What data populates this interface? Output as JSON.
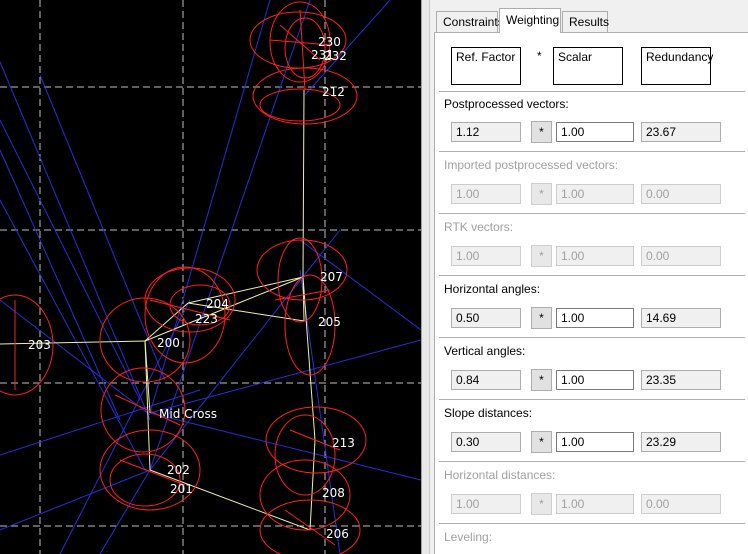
{
  "tabs": [
    "Constraints",
    "Weighting",
    "Results"
  ],
  "active_tab": "Weighting",
  "header": {
    "ref_factor": "Ref. Factor",
    "multiply": "*",
    "scalar": "Scalar",
    "redundancy": "Redundancy"
  },
  "sections": [
    {
      "title": "Postprocessed vectors:",
      "ref": "1.12",
      "op": "*",
      "scalar": "1.00",
      "redundancy": "23.67",
      "enabled": true
    },
    {
      "title": "Imported postprocessed vectors:",
      "ref": "1.00",
      "op": "*",
      "scalar": "1.00",
      "redundancy": "0.00",
      "enabled": false
    },
    {
      "title": "RTK vectors:",
      "ref": "1.00",
      "op": "*",
      "scalar": "1.00",
      "redundancy": "0.00",
      "enabled": false
    },
    {
      "title": "Horizontal angles:",
      "ref": "0.50",
      "op": "*",
      "scalar": "1.00",
      "redundancy": "14.69",
      "enabled": true
    },
    {
      "title": "Vertical angles:",
      "ref": "0.84",
      "op": "*",
      "scalar": "1.00",
      "redundancy": "23.35",
      "enabled": true
    },
    {
      "title": "Slope distances:",
      "ref": "0.30",
      "op": "*",
      "scalar": "1.00",
      "redundancy": "23.29",
      "enabled": true
    },
    {
      "title": "Horizontal distances:",
      "ref": "1.00",
      "op": "*",
      "scalar": "1.00",
      "redundancy": "0.00",
      "enabled": false
    },
    {
      "title": "Leveling:",
      "enabled": false
    }
  ],
  "map": {
    "points": [
      "230",
      "231",
      "232",
      "212",
      "207",
      "205",
      "204",
      "223",
      "200",
      "203",
      "Mid Cross",
      "202",
      "201",
      "213",
      "208",
      "206"
    ],
    "colors": {
      "background": "#000000",
      "ellipse": "#ff2020",
      "network_line": "#f0f0a8",
      "ray": "#2020e0",
      "grid": "#ffffff",
      "label": "#ffffff"
    }
  }
}
